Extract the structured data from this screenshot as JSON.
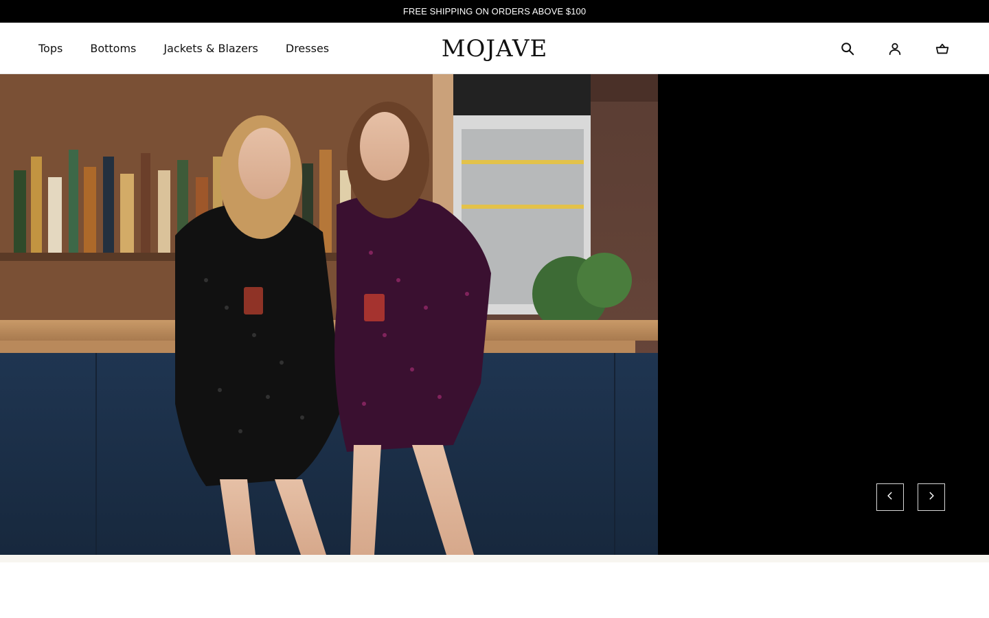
{
  "announcement": {
    "text": "FREE SHIPPING ON ORDERS ABOVE $100"
  },
  "nav": {
    "items": [
      {
        "label": "Tops"
      },
      {
        "label": "Bottoms"
      },
      {
        "label": "Jackets & Blazers"
      },
      {
        "label": "Dresses"
      }
    ]
  },
  "brand": {
    "logo_text": "MOJAVE"
  },
  "header_icons": [
    "search-icon",
    "account-icon",
    "cart-icon"
  ],
  "hero": {
    "image_alt": "Two women in sequin blazer dresses at a bar",
    "slider_icons": [
      "chevron-left-icon",
      "chevron-right-icon"
    ]
  },
  "colors": {
    "announcement_bg": "#000000",
    "announcement_text": "#ffffff",
    "hero_panel": "#000000",
    "below_strip": "#f7f5f0"
  }
}
